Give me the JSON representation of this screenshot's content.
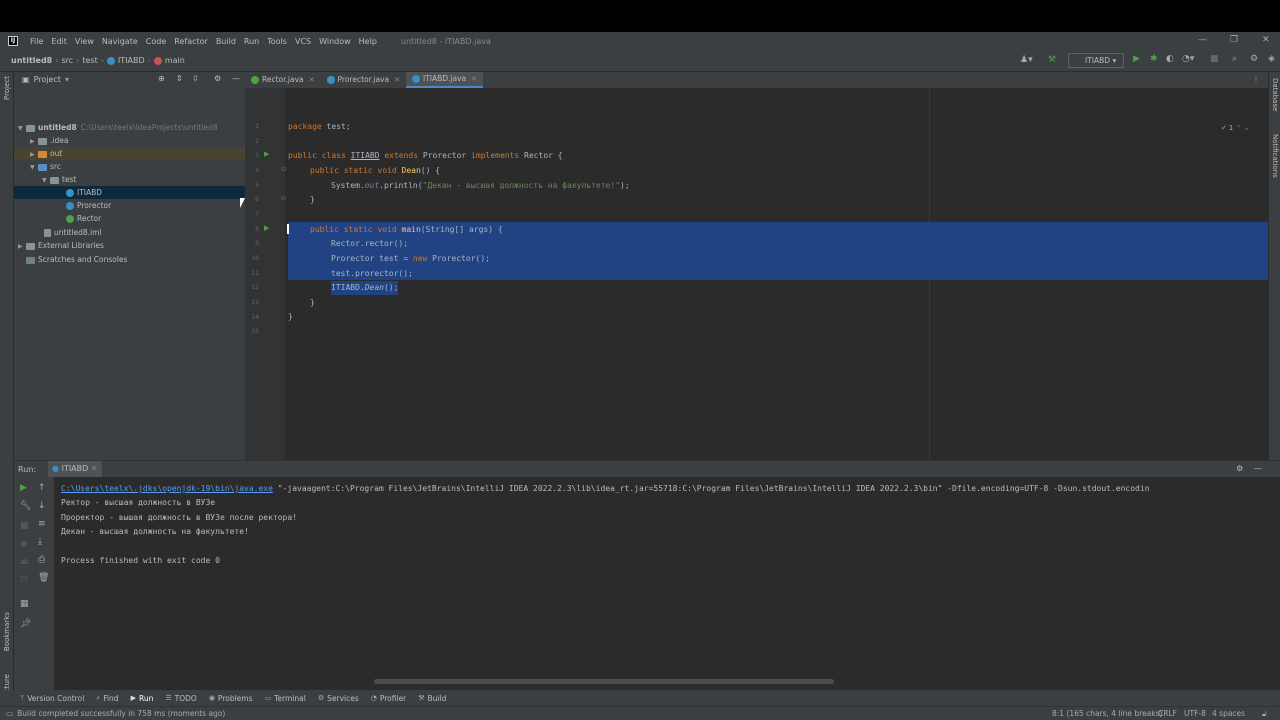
{
  "window": {
    "title": "untitled8 - ITIABD.java",
    "menu": [
      "File",
      "Edit",
      "View",
      "Navigate",
      "Code",
      "Refactor",
      "Build",
      "Run",
      "Tools",
      "VCS",
      "Window",
      "Help"
    ]
  },
  "navbar": {
    "crumbs": [
      "untitled8",
      "src",
      "test",
      "ITIABD",
      "main"
    ],
    "run_config": "ITIABD"
  },
  "project": {
    "header": "Project",
    "tree": [
      {
        "label": "untitled8",
        "path": "C:\\Users\\teelx\\IdeaProjects\\untitled8",
        "icon": "folder"
      },
      {
        "label": ".idea",
        "icon": "folder"
      },
      {
        "label": "out",
        "icon": "folder-orange"
      },
      {
        "label": "src",
        "icon": "folder-blue"
      },
      {
        "label": "test",
        "icon": "package"
      },
      {
        "label": "ITIABD",
        "icon": "class"
      },
      {
        "label": "Prorector",
        "icon": "class"
      },
      {
        "label": "Rector",
        "icon": "class"
      },
      {
        "label": "untitled8.iml",
        "icon": "file"
      },
      {
        "label": "External Libraries",
        "icon": "library"
      },
      {
        "label": "Scratches and Consoles",
        "icon": "scratch"
      }
    ]
  },
  "editor": {
    "tabs": [
      {
        "label": "Rector.java"
      },
      {
        "label": "Prorector.java"
      },
      {
        "label": "ITIABD.java",
        "active": true
      }
    ],
    "inspections": "1",
    "line_numbers": [
      "1",
      "2",
      "3",
      "4",
      "5",
      "6",
      "7",
      "8",
      "9",
      "10",
      "11",
      "12",
      "13",
      "14",
      "15"
    ],
    "code": {
      "l1_kw": "package",
      "l1_rest": " test;",
      "l3_kw1": "public class ",
      "l3_name": "ITIABD",
      "l3_kw2": " extends ",
      "l3_base": "Prorector",
      "l3_kw3": " implements ",
      "l3_iface": "Rector {",
      "l4_kw": "public static void ",
      "l4_fn": "Dean",
      "l4_rest": "() {",
      "l5_a": "System.",
      "l5_out": "out",
      "l5_b": ".println(",
      "l5_str": "\"Декан - высшая должность на факультете!\"",
      "l5_c": ");",
      "l6": "}",
      "l8_kw": "public static void ",
      "l8_fn": "main",
      "l8_rest": "(String[] args) {",
      "l9": "Rector.rector();",
      "l10_a": "Prorector test = ",
      "l10_kw": "new",
      "l10_b": " Prorector();",
      "l11": "test.prorector();",
      "l12_a": "ITIABD.",
      "l12_fn": "Dean",
      "l12_b": "();",
      "l13": "}",
      "l14": "}"
    }
  },
  "run": {
    "label": "Run:",
    "tab": "ITIABD",
    "command_link": "C:\\Users\\teelx\\.jdks\\openjdk-19\\bin\\java.exe",
    "command_rest": " \"-javaagent:C:\\Program Files\\JetBrains\\IntelliJ IDEA 2022.2.3\\lib\\idea_rt.jar=55718:C:\\Program Files\\JetBrains\\IntelliJ IDEA 2022.2.3\\bin\" -Dfile.encoding=UTF-8 -Dsun.stdout.encodin",
    "output": [
      "Ректор - высшая должность в ВУЗе",
      "Проректор - вышая должность в ВУЗе после ректора!",
      "Декан - высшая должность на факультете!"
    ],
    "exit": "Process finished with exit code 0"
  },
  "bottom_tools": [
    {
      "label": "Version Control",
      "icon": "vcs-icon"
    },
    {
      "label": "Find",
      "icon": "search-icon"
    },
    {
      "label": "Run",
      "icon": "run-icon",
      "active": true
    },
    {
      "label": "TODO",
      "icon": "todo-icon"
    },
    {
      "label": "Problems",
      "icon": "problems-icon"
    },
    {
      "label": "Terminal",
      "icon": "terminal-icon"
    },
    {
      "label": "Services",
      "icon": "services-icon"
    },
    {
      "label": "Profiler",
      "icon": "profiler-icon"
    },
    {
      "label": "Build",
      "icon": "build-icon"
    }
  ],
  "status": {
    "message": "Build completed successfully in 758 ms (moments ago)",
    "position": "8:1 (165 chars, 4 line breaks)",
    "line_sep": "CRLF",
    "encoding": "UTF-8",
    "indent": "4 spaces"
  },
  "side_labels": {
    "project": "Project",
    "bookmarks": "Bookmarks",
    "structure": "Structure",
    "database": "Database",
    "notifications": "Notifications"
  }
}
